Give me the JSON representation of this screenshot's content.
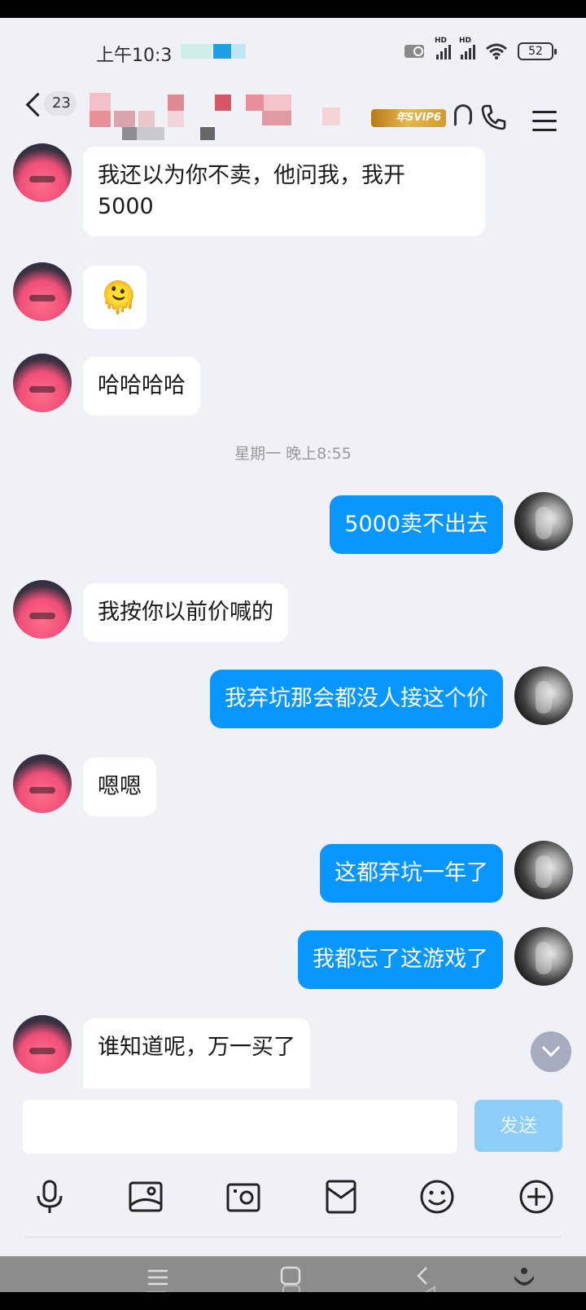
{
  "status_bar": {
    "time": "上午10:3",
    "battery": "52",
    "signal_1": "HD",
    "signal_2": "HD"
  },
  "header": {
    "unread_count": "23",
    "vip_badge": "年SVIP6"
  },
  "messages": [
    {
      "side": "in",
      "text_lines": [
        "我还以为你不卖，他问我，我开",
        "5000"
      ]
    },
    {
      "side": "in",
      "emoji": "🫠"
    },
    {
      "side": "in",
      "text": "哈哈哈哈"
    },
    {
      "timestamp": "星期一 晚上8:55"
    },
    {
      "side": "out",
      "text": "5000卖不出去"
    },
    {
      "side": "in",
      "text": "我按你以前价喊的"
    },
    {
      "side": "out",
      "text": "我弃坑那会都没人接这个价"
    },
    {
      "side": "in",
      "text": "嗯嗯"
    },
    {
      "side": "out",
      "text": "这都弃坑一年了"
    },
    {
      "side": "out",
      "text": "我都忘了这游戏了"
    },
    {
      "side": "in",
      "text": "谁知道呢，万一买了"
    }
  ],
  "input": {
    "value": "",
    "send_label": "发送"
  },
  "toolbar_icons": [
    "microphone-icon",
    "image-icon",
    "camera-icon",
    "red-packet-icon",
    "emoji-icon",
    "plus-icon"
  ],
  "colors": {
    "outgoing_bubble": "#0a96ff",
    "incoming_bubble": "#ffffff",
    "background": "#f0f1f6",
    "send_button": "#8dcdf7"
  }
}
